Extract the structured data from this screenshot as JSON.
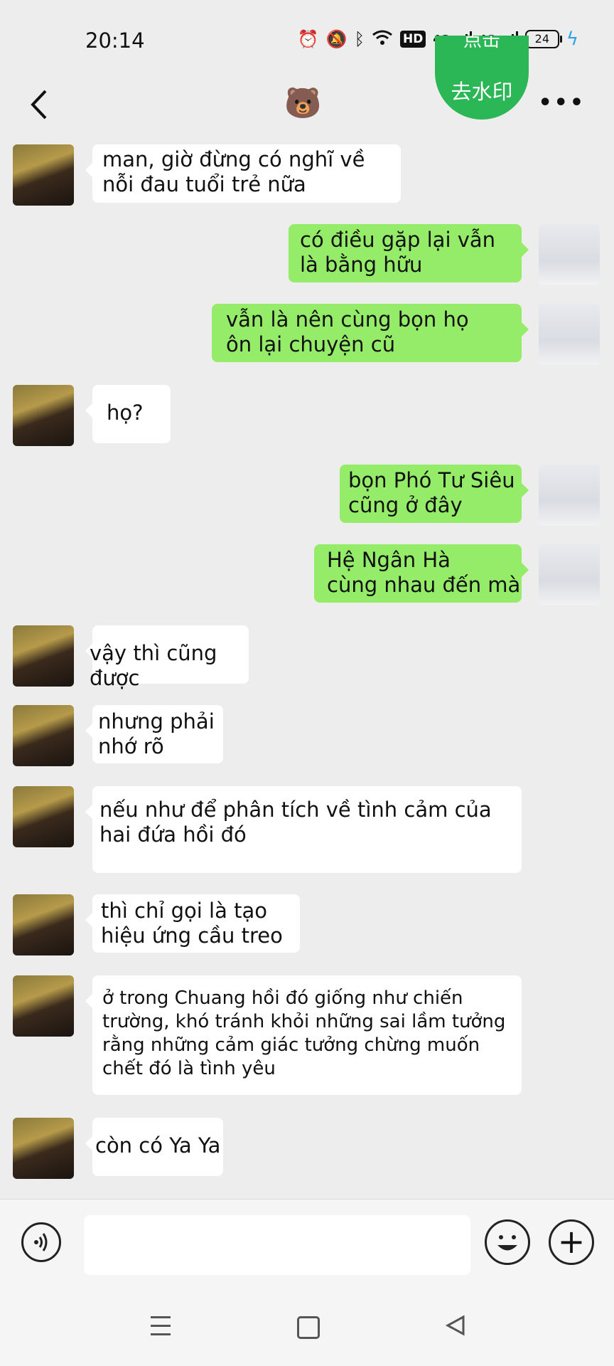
{
  "status": {
    "time": "20:14",
    "icons": [
      "alarm-icon",
      "mute-icon",
      "bluetooth-icon",
      "wifi-icon"
    ],
    "hd": "HD",
    "net1": "4G",
    "net2": "4G",
    "battery": "24"
  },
  "header": {
    "title_icon": "🐻",
    "badge_top": "点击",
    "badge_text": "去水印",
    "more": "•••"
  },
  "messages": [
    {
      "side": "in",
      "text": "man, giờ đừng có nghĩ về\nnỗi đau tuổi trẻ nữa"
    },
    {
      "side": "out",
      "text": "có điều gặp lại vẫn\nlà bằng hữu"
    },
    {
      "side": "out",
      "text": "vẫn là nên cùng bọn họ\nôn lại chuyện cũ"
    },
    {
      "side": "in",
      "text": "họ?"
    },
    {
      "side": "out",
      "text": "bọn Phó Tư Siêu\ncũng ở đây"
    },
    {
      "side": "out",
      "text": "Hệ Ngân Hà\ncùng nhau đến mà"
    },
    {
      "side": "in",
      "text": "vậy thì cũng được"
    },
    {
      "side": "in",
      "text": "nhưng phải\nnhớ rõ"
    },
    {
      "side": "in",
      "text": "nếu như để phân tích về tình cảm của\nhai đứa hồi đó"
    },
    {
      "side": "in",
      "text": "thì chỉ gọi là tạo\nhiệu ứng cầu treo"
    },
    {
      "side": "in",
      "text": "ở trong Chuang hồi đó giống như chiến\ntrường, khó tránh khỏi những sai lầm tưởng\nrằng những cảm giác tưởng chừng muốn\nchết đó là tình yêu"
    },
    {
      "side": "in",
      "text": "còn có Ya Ya"
    }
  ],
  "input": {
    "value": "",
    "placeholder": ""
  },
  "colors": {
    "outgoing_bubble": "#95ec69",
    "incoming_bubble": "#ffffff",
    "background": "#ededed",
    "badge": "#2bb756"
  }
}
